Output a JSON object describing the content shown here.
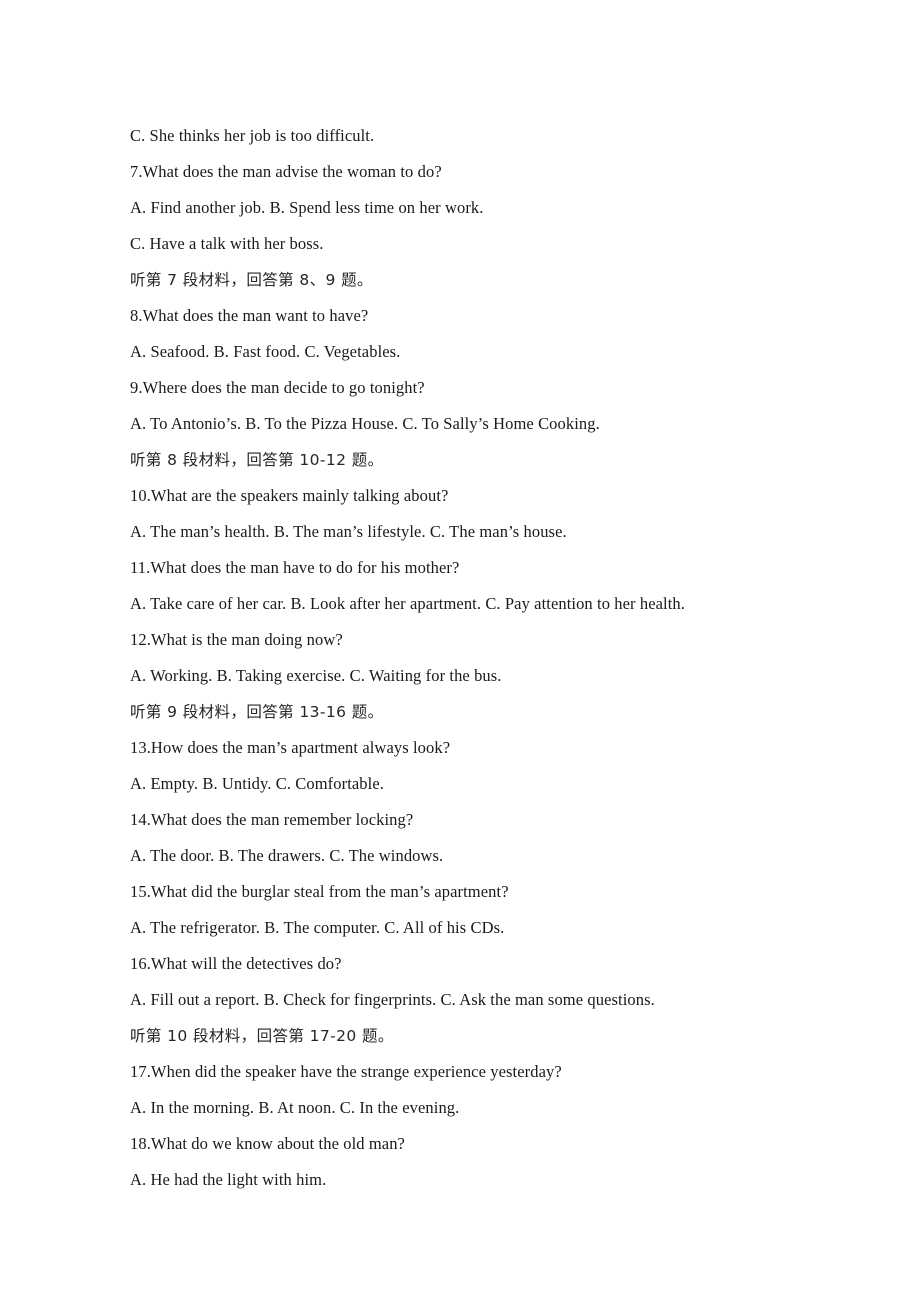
{
  "page": {
    "background_color": "#ffffff",
    "text_color": "#1a1a1a",
    "language_mix": "English questions with Chinese section directions"
  },
  "lines": [
    {
      "id": "l01",
      "type": "option_row",
      "text": "C. She thinks her job is too difficult.",
      "options": [
        {
          "letter": "C.",
          "text": "She thinks her job is too difficult."
        }
      ]
    },
    {
      "id": "l02",
      "type": "question",
      "number": "7.",
      "text": "7.What does the man advise the woman to do?",
      "stem": "What does the man advise the woman to do?"
    },
    {
      "id": "l03",
      "type": "option_row",
      "text": "A. Find another job.        B. Spend less time on her work.",
      "options": [
        {
          "letter": "A.",
          "text": "Find another job."
        },
        {
          "letter": "B.",
          "text": "Spend less time on her work."
        }
      ]
    },
    {
      "id": "l04",
      "type": "option_row",
      "text": "C. Have a talk with her boss.",
      "options": [
        {
          "letter": "C.",
          "text": "Have a talk with her boss."
        }
      ]
    },
    {
      "id": "l05",
      "type": "direction_cn",
      "text": "听第 7 段材料，回答第 8、9 题。"
    },
    {
      "id": "l06",
      "type": "question",
      "number": "8.",
      "text": "8.What does the man want to have?",
      "stem": "What does the man want to have?"
    },
    {
      "id": "l07",
      "type": "option_row",
      "text": "A. Seafood.        B. Fast food.        C. Vegetables.",
      "options": [
        {
          "letter": "A.",
          "text": "Seafood."
        },
        {
          "letter": "B.",
          "text": "Fast food."
        },
        {
          "letter": "C.",
          "text": "Vegetables."
        }
      ]
    },
    {
      "id": "l08",
      "type": "question",
      "number": "9.",
      "text": "9.Where does the man decide to go tonight?",
      "stem": "Where does the man decide to go tonight?"
    },
    {
      "id": "l09",
      "type": "option_row",
      "text": "A. To Antonio’s.        B. To the Pizza House.        C. To Sally’s Home Cooking.",
      "options": [
        {
          "letter": "A.",
          "text": "To Antonio’s."
        },
        {
          "letter": "B.",
          "text": "To the Pizza House."
        },
        {
          "letter": "C.",
          "text": "To Sally’s Home Cooking."
        }
      ]
    },
    {
      "id": "l10",
      "type": "direction_cn",
      "text": "听第 8 段材料，回答第 10-12 题。"
    },
    {
      "id": "l11",
      "type": "question",
      "number": "10.",
      "text": "10.What are the speakers mainly talking about?",
      "stem": "What are the speakers mainly talking about?"
    },
    {
      "id": "l12",
      "type": "option_row",
      "text": "A. The man’s health.        B. The man’s lifestyle.        C. The man’s house.",
      "options": [
        {
          "letter": "A.",
          "text": "The man’s health."
        },
        {
          "letter": "B.",
          "text": "The man’s lifestyle."
        },
        {
          "letter": "C.",
          "text": "The man’s house."
        }
      ]
    },
    {
      "id": "l13",
      "type": "question",
      "number": "11.",
      "text": "11.What does the man have to do for his mother?",
      "stem": "What does the man have to do for his mother?"
    },
    {
      "id": "l14",
      "type": "option_row",
      "text": "A. Take care of her car.        B. Look after her apartment.        C. Pay attention to her health.",
      "options": [
        {
          "letter": "A.",
          "text": "Take care of her car."
        },
        {
          "letter": "B.",
          "text": "Look after her apartment."
        },
        {
          "letter": "C.",
          "text": "Pay attention to her health."
        }
      ]
    },
    {
      "id": "l15",
      "type": "question",
      "number": "12.",
      "text": "12.What is the man doing now?",
      "stem": "What is the man doing now?"
    },
    {
      "id": "l16",
      "type": "option_row",
      "text": "A. Working.        B. Taking exercise.        C. Waiting for the bus.",
      "options": [
        {
          "letter": "A.",
          "text": "Working."
        },
        {
          "letter": "B.",
          "text": "Taking exercise."
        },
        {
          "letter": "C.",
          "text": "Waiting for the bus."
        }
      ]
    },
    {
      "id": "l17",
      "type": "direction_cn",
      "text": "听第 9 段材料，回答第 13-16 题。"
    },
    {
      "id": "l18",
      "type": "question",
      "number": "13.",
      "text": "13.How does the man’s apartment always look?",
      "stem": "How does the man’s apartment always look?"
    },
    {
      "id": "l19",
      "type": "option_row",
      "text": "A. Empty.        B. Untidy.        C. Comfortable.",
      "options": [
        {
          "letter": "A.",
          "text": "Empty."
        },
        {
          "letter": "B.",
          "text": "Untidy."
        },
        {
          "letter": "C.",
          "text": "Comfortable."
        }
      ]
    },
    {
      "id": "l20",
      "type": "question",
      "number": "14.",
      "text": "14.What does the man remember locking?",
      "stem": "What does the man remember locking?"
    },
    {
      "id": "l21",
      "type": "option_row",
      "text": "A. The door.        B. The drawers.        C. The windows.",
      "options": [
        {
          "letter": "A.",
          "text": "The door."
        },
        {
          "letter": "B.",
          "text": "The drawers."
        },
        {
          "letter": "C.",
          "text": "The windows."
        }
      ]
    },
    {
      "id": "l22",
      "type": "question",
      "number": "15.",
      "text": "15.What did the burglar steal from the man’s apartment?",
      "stem": "What did the burglar steal from the man’s apartment?"
    },
    {
      "id": "l23",
      "type": "option_row",
      "text": "A. The refrigerator.        B. The computer.        C. All of his CDs.",
      "options": [
        {
          "letter": "A.",
          "text": "The refrigerator."
        },
        {
          "letter": "B.",
          "text": "The computer."
        },
        {
          "letter": "C.",
          "text": "All of his CDs."
        }
      ]
    },
    {
      "id": "l24",
      "type": "question",
      "number": "16.",
      "text": "16.What will the detectives do?",
      "stem": "What will the detectives do?"
    },
    {
      "id": "l25",
      "type": "option_row",
      "text": "A. Fill out a report.        B. Check for fingerprints.        C. Ask the man some questions.",
      "options": [
        {
          "letter": "A.",
          "text": "Fill out a report."
        },
        {
          "letter": "B.",
          "text": "Check for fingerprints."
        },
        {
          "letter": "C.",
          "text": "Ask the man some questions."
        }
      ]
    },
    {
      "id": "l26",
      "type": "direction_cn",
      "text": "听第 10 段材料，回答第 17-20 题。"
    },
    {
      "id": "l27",
      "type": "question",
      "number": "17.",
      "text": "17.When did the speaker have the strange experience yesterday?",
      "stem": "When did the speaker have the strange experience yesterday?"
    },
    {
      "id": "l28",
      "type": "option_row",
      "text": "A. In the morning.        B. At noon.        C. In the evening.",
      "options": [
        {
          "letter": "A.",
          "text": "In the morning."
        },
        {
          "letter": "B.",
          "text": "At noon."
        },
        {
          "letter": "C.",
          "text": "In the evening."
        }
      ]
    },
    {
      "id": "l29",
      "type": "question",
      "number": "18.",
      "text": "18.What do we know about the old man?",
      "stem": "What do we know about the old man?"
    },
    {
      "id": "l30",
      "type": "option_row",
      "text": "A. He had the light with him.",
      "options": [
        {
          "letter": "A.",
          "text": "He had the light with him."
        }
      ]
    }
  ]
}
